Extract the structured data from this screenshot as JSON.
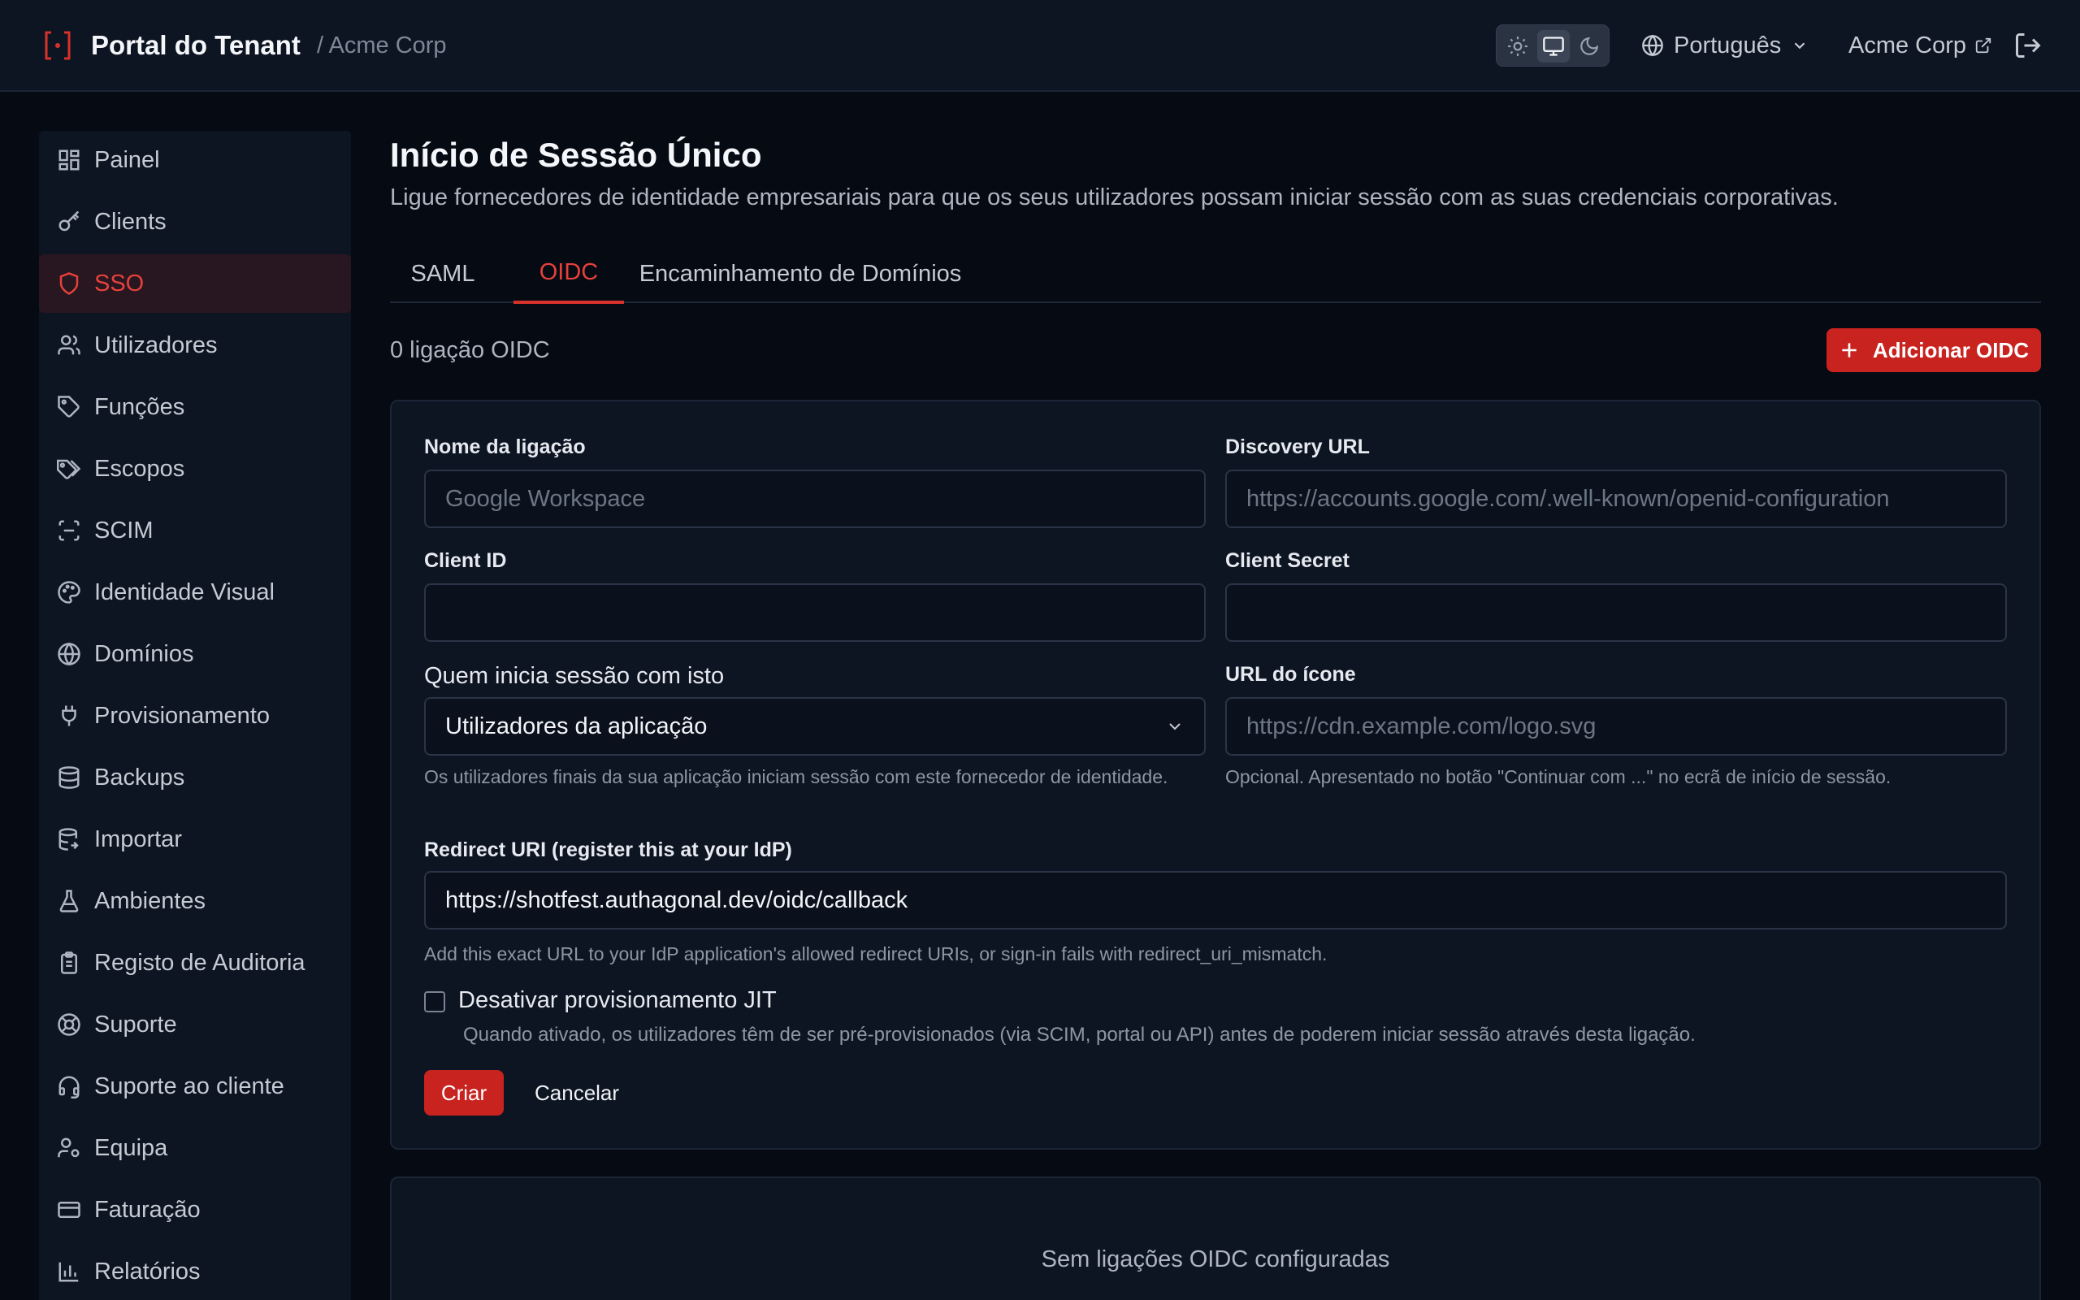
{
  "header": {
    "app_title": "Portal do Tenant",
    "tenant_crumb": "/ Acme Corp",
    "language": "Português",
    "tenant_link": "Acme Corp",
    "theme_options": [
      "sun-icon",
      "monitor-icon",
      "moon-icon"
    ],
    "theme_selected": "monitor-icon"
  },
  "sidebar": {
    "items": [
      {
        "label": "Painel",
        "icon": "dashboard-icon"
      },
      {
        "label": "Clients",
        "icon": "key-icon"
      },
      {
        "label": "SSO",
        "icon": "shield-icon",
        "active": true
      },
      {
        "label": "Utilizadores",
        "icon": "users-icon"
      },
      {
        "label": "Funções",
        "icon": "tag-icon"
      },
      {
        "label": "Escopos",
        "icon": "tags-icon"
      },
      {
        "label": "SCIM",
        "icon": "scan-icon"
      },
      {
        "label": "Identidade Visual",
        "icon": "palette-icon"
      },
      {
        "label": "Domínios",
        "icon": "globe-icon"
      },
      {
        "label": "Provisionamento",
        "icon": "plug-icon"
      },
      {
        "label": "Backups",
        "icon": "database-icon"
      },
      {
        "label": "Importar",
        "icon": "database-import-icon"
      },
      {
        "label": "Ambientes",
        "icon": "flask-icon"
      },
      {
        "label": "Registo de Auditoria",
        "icon": "clipboard-icon"
      },
      {
        "label": "Suporte",
        "icon": "lifebuoy-icon"
      },
      {
        "label": "Suporte ao cliente",
        "icon": "headset-icon"
      },
      {
        "label": "Equipa",
        "icon": "user-cog-icon"
      },
      {
        "label": "Faturação",
        "icon": "credit-card-icon"
      },
      {
        "label": "Relatórios",
        "icon": "bar-chart-icon"
      }
    ]
  },
  "page": {
    "title": "Início de Sessão Único",
    "description": "Ligue fornecedores de identidade empresariais para que os seus utilizadores possam iniciar sessão com as suas credenciais corporativas.",
    "tabs": [
      {
        "label": "SAML"
      },
      {
        "label": "OIDC",
        "active": true
      },
      {
        "label": "Encaminhamento de Domínios"
      }
    ],
    "connection_count": "0 ligação OIDC",
    "add_button": "Adicionar OIDC"
  },
  "form": {
    "name_label": "Nome da ligação",
    "name_placeholder": "Google Workspace",
    "name_value": "",
    "discovery_label": "Discovery URL",
    "discovery_placeholder": "https://accounts.google.com/.well-known/openid-configuration",
    "discovery_value": "",
    "client_id_label": "Client ID",
    "client_id_value": "",
    "client_secret_label": "Client Secret",
    "client_secret_value": "",
    "who_label": "Quem inicia sessão com isto",
    "who_value": "Utilizadores da aplicação",
    "who_help": "Os utilizadores finais da sua aplicação iniciam sessão com este fornecedor de identidade.",
    "icon_url_label": "URL do ícone",
    "icon_url_placeholder": "https://cdn.example.com/logo.svg",
    "icon_url_value": "",
    "icon_url_help": "Opcional. Apresentado no botão \"Continuar com ...\" no ecrã de início de sessão.",
    "redirect_label": "Redirect URI (register this at your IdP)",
    "redirect_value": "https://shotfest.authagonal.dev/oidc/callback",
    "redirect_help": "Add this exact URL to your IdP application's allowed redirect URIs, or sign-in fails with redirect_uri_mismatch.",
    "jit_label": "Desativar provisionamento JIT",
    "jit_checked": false,
    "jit_help": "Quando ativado, os utilizadores têm de ser pré-provisionados (via SCIM, portal ou API) antes de poderem iniciar sessão através desta ligação.",
    "create_button": "Criar",
    "cancel_button": "Cancelar"
  },
  "empty_state": {
    "text": "Sem ligações OIDC configuradas"
  },
  "colors": {
    "accent": "#c8231f",
    "accent_text": "#e5413a",
    "background": "#060a13",
    "panel": "#0d1522"
  }
}
